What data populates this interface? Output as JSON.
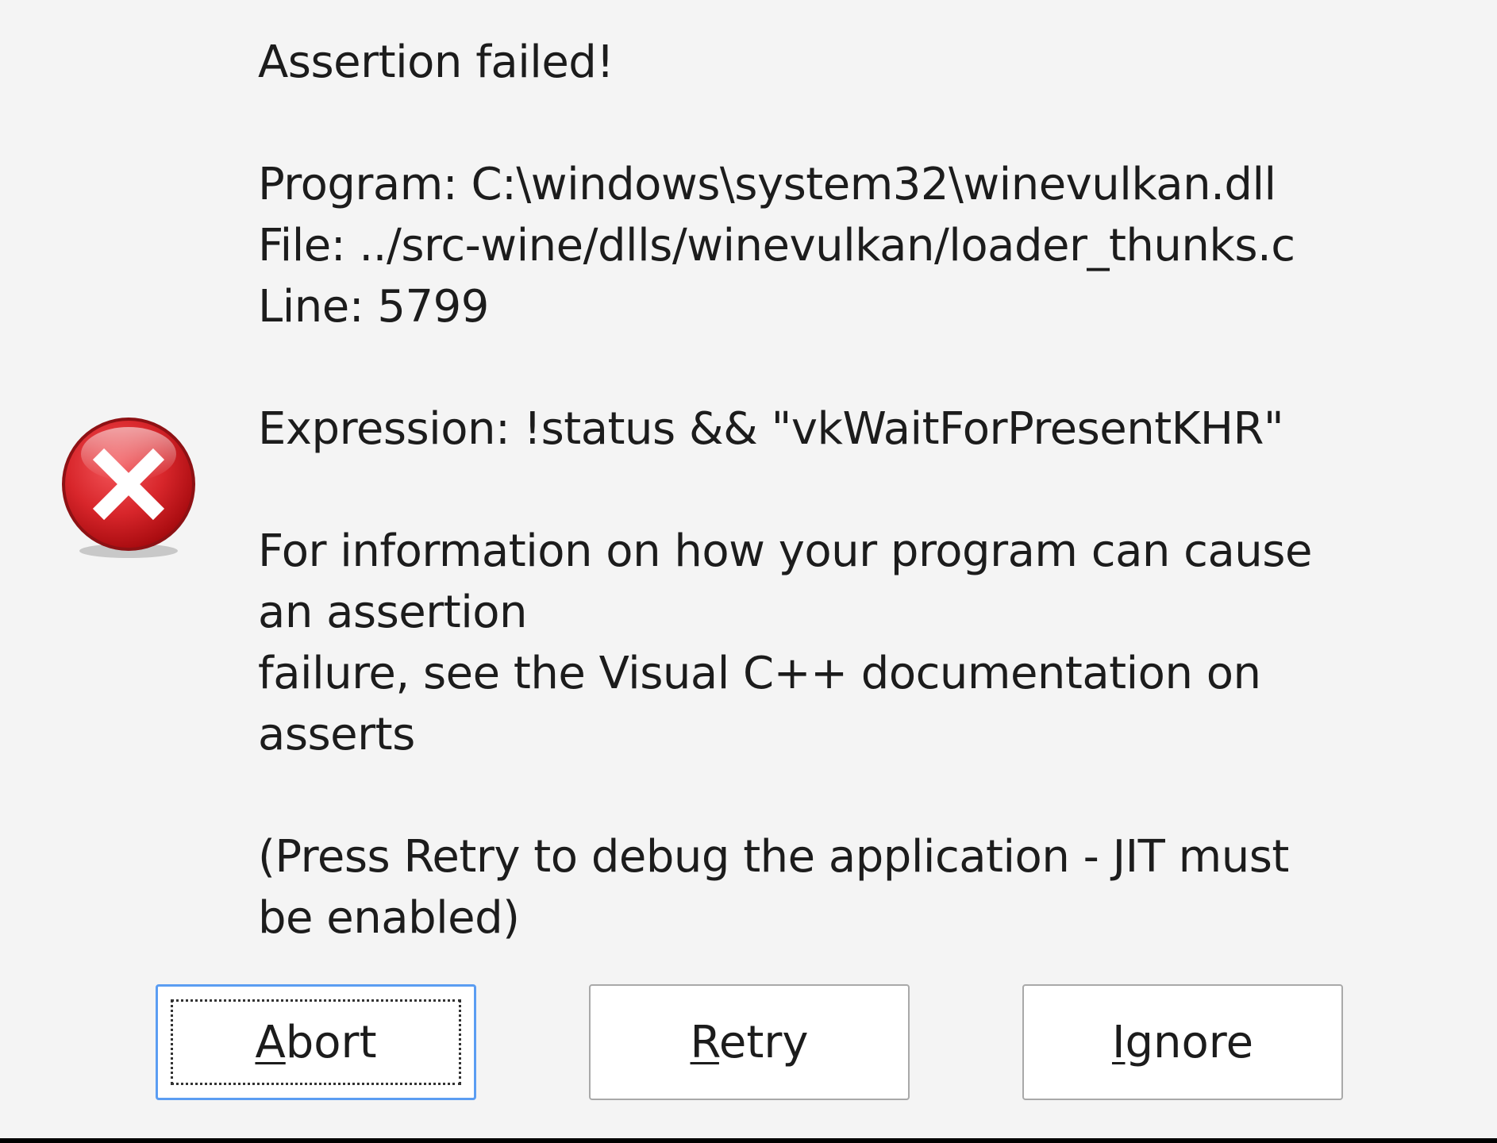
{
  "dialog": {
    "icon": "error-icon",
    "accent_color": "#d8262b",
    "lines": {
      "heading": "Assertion failed!",
      "program": "Program: C:\\windows\\system32\\winevulkan.dll",
      "file": "File: ../src-wine/dlls/winevulkan/loader_thunks.c",
      "line": "Line: 5799",
      "expression": "Expression: !status && \"vkWaitForPresentKHR\"",
      "info_1": "For information on how your program can cause",
      "info_2": "an assertion",
      "info_3": "failure, see the Visual C++ documentation on",
      "info_4": "asserts",
      "press_1": "(Press Retry to debug the application - JIT must",
      "press_2": "be enabled)"
    }
  },
  "buttons": {
    "abort": {
      "mnemonic": "A",
      "rest": "bort"
    },
    "retry": {
      "mnemonic": "R",
      "rest": "etry"
    },
    "ignore": {
      "mnemonic": "I",
      "rest": "gnore"
    }
  }
}
